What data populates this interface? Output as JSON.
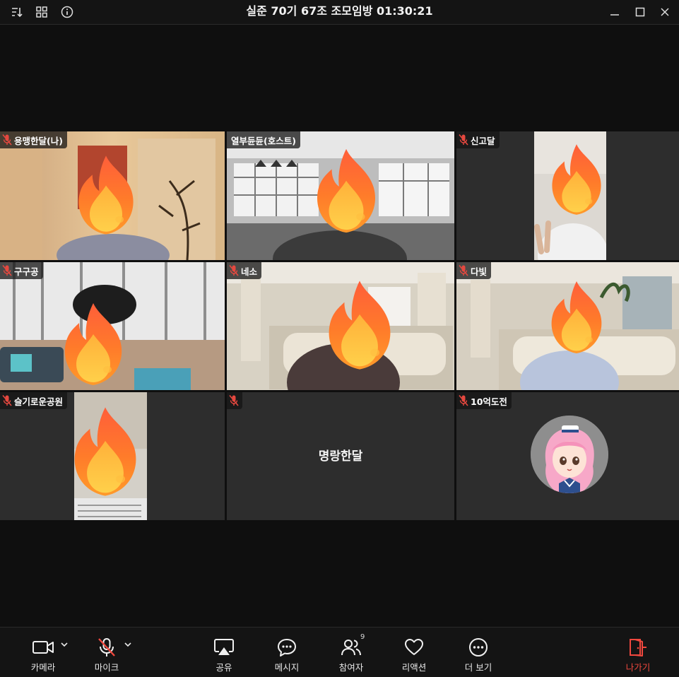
{
  "window": {
    "title": "실준 70기 67조 조모임방 01:30:21"
  },
  "participants": [
    {
      "name": "용맹한달(나)",
      "muted": true
    },
    {
      "name": "열부듄듄(호스트)",
      "muted": false
    },
    {
      "name": "신고달",
      "muted": true
    },
    {
      "name": "구구공",
      "muted": true
    },
    {
      "name": "네소",
      "muted": true
    },
    {
      "name": "다빛",
      "muted": true
    },
    {
      "name": "슬기로운공원",
      "muted": true
    },
    {
      "name": "",
      "muted": true,
      "center_name": "명랑한달"
    },
    {
      "name": "10억도전",
      "muted": true
    }
  ],
  "toolbar": {
    "camera": "카메라",
    "mic": "마이크",
    "share": "공유",
    "message": "메시지",
    "participants": "참여자",
    "participants_count": "9",
    "reaction": "리액션",
    "more": "더 보기",
    "leave": "나가기"
  },
  "colors": {
    "background": "#0f0f0f",
    "tile": "#2d2d2d",
    "muted_icon": "#e5483f",
    "leave": "#f0483e"
  }
}
